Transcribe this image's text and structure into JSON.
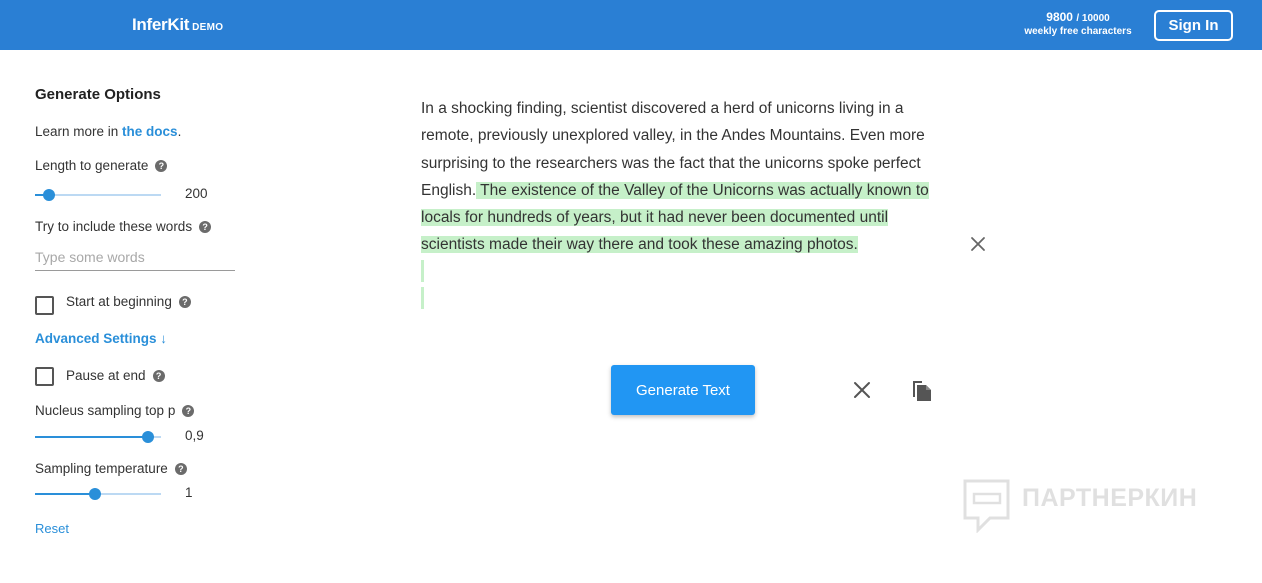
{
  "header": {
    "logo": "InferKit",
    "logo_tag": "DEMO",
    "credits_used": "9800",
    "credits_total": "/ 10000",
    "credits_label": "weekly free characters",
    "signin_label": "Sign In"
  },
  "sidebar": {
    "title": "Generate Options",
    "learn_prefix": "Learn more in ",
    "learn_link": "the docs",
    "learn_suffix": ".",
    "length": {
      "label": "Length to generate",
      "value": "200",
      "fraction": 0.11
    },
    "include": {
      "label": "Try to include these words",
      "placeholder": "Type some words",
      "value": ""
    },
    "start_at_beginning": {
      "label": "Start at beginning",
      "checked": false
    },
    "advanced_label": "Advanced Settings ↓",
    "pause_at_end": {
      "label": "Pause at end",
      "checked": false
    },
    "top_p": {
      "label": "Nucleus sampling top p",
      "value": "0,9",
      "fraction": 0.9
    },
    "temperature": {
      "label": "Sampling temperature",
      "value": "1",
      "fraction": 0.48
    },
    "reset_label": "Reset",
    "help_glyph": "?"
  },
  "story": {
    "prompt": "In a shocking finding, scientist discovered a herd of unicorns living in a remote, previously unexplored valley, in the Andes Mountains. Even more surprising to the researchers was the fact that the unicorns spoke perfect English.",
    "generated": " The existence of the Valley of the Unicorns was actually known to locals for hundreds of years, but it had never been documented until scientists made their way there and took these amazing photos.",
    "highlight_color": "#c6f0c9"
  },
  "actions": {
    "generate_label": "Generate Text",
    "clear_icon": "close-icon",
    "copy_icon": "copy-icon"
  },
  "watermark": {
    "text": "ПАРТНЕРКИН"
  },
  "colors": {
    "header": "#2a7fd4",
    "accent": "#2196f3",
    "link": "#2a8fd9"
  }
}
